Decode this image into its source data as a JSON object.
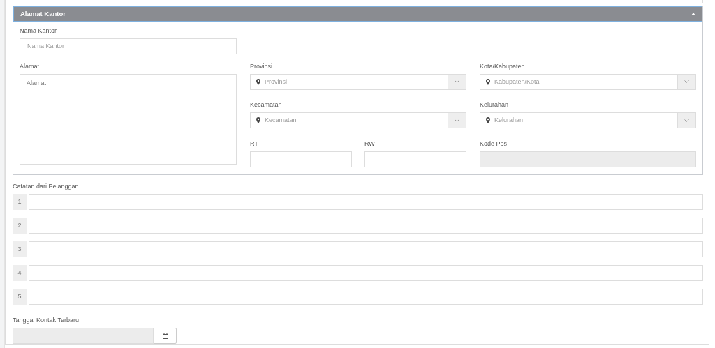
{
  "section": {
    "title": "Alamat Kantor",
    "expanded": true
  },
  "office_name": {
    "label": "Nama Kantor",
    "placeholder": "Nama Kantor"
  },
  "address": {
    "label": "Alamat",
    "placeholder": "Alamat"
  },
  "selects": [
    {
      "label": "Provinsi",
      "placeholder": "Provinsi"
    },
    {
      "label": "Kota/Kabupaten",
      "placeholder": "Kabupaten/Kota"
    },
    {
      "label": "Kecamatan",
      "placeholder": "Kecamatan"
    },
    {
      "label": "Kelurahan",
      "placeholder": "Kelurahan"
    }
  ],
  "rt": {
    "label": "RT"
  },
  "rw": {
    "label": "RW"
  },
  "postal_code": {
    "label": "Kode Pos",
    "disabled": true
  },
  "notes": {
    "label": "Catatan dari Pelanggan",
    "rows": [
      {
        "number": "1"
      },
      {
        "number": "2"
      },
      {
        "number": "3"
      },
      {
        "number": "4"
      },
      {
        "number": "5"
      }
    ]
  },
  "last_contact": {
    "label": "Tanggal Kontak Terbaru",
    "disabled": true
  }
}
